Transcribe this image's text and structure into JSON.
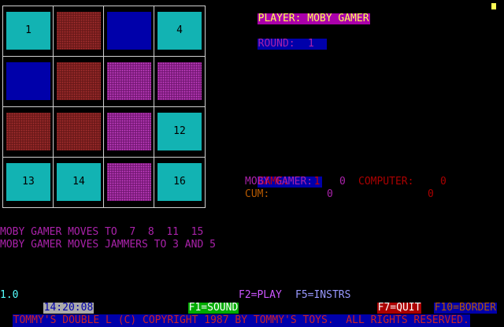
{
  "board": {
    "tiles": [
      {
        "label": "1",
        "color": "cyan"
      },
      {
        "label": "",
        "color": "brown"
      },
      {
        "label": "",
        "color": "blue"
      },
      {
        "label": "4",
        "color": "cyan"
      },
      {
        "label": "",
        "color": "blue"
      },
      {
        "label": "",
        "color": "brown"
      },
      {
        "label": "",
        "color": "magenta"
      },
      {
        "label": "",
        "color": "magenta"
      },
      {
        "label": "",
        "color": "brown"
      },
      {
        "label": "",
        "color": "brown"
      },
      {
        "label": "",
        "color": "magenta"
      },
      {
        "label": "12",
        "color": "cyan"
      },
      {
        "label": "13",
        "color": "cyan"
      },
      {
        "label": "14",
        "color": "cyan"
      },
      {
        "label": "",
        "color": "magenta"
      },
      {
        "label": "16",
        "color": "cyan"
      }
    ]
  },
  "player": {
    "label": "PLAYER: MOBY GAMER"
  },
  "round": {
    "label": "ROUND:",
    "value": "1"
  },
  "scores": {
    "game_label": "GAME:",
    "game_value": "1",
    "player_label": "MOBY GAMER:",
    "player_score": "0",
    "computer_label": "COMPUTER:",
    "computer_score": "0",
    "cum_label": "CUM:",
    "cum_player": "0",
    "cum_computer": "0"
  },
  "messages": [
    "MOBY GAMER MOVES TO  7  8  11  15",
    "MOBY GAMER MOVES JAMMERS TO 3 AND 5"
  ],
  "status": {
    "version": "1.0",
    "time": "14:20:08",
    "f1": "F1=SOUND",
    "f2": "F2=PLAY",
    "f5": "F5=INSTRS",
    "f7": "F7=QUIT",
    "f10": "F10=BORDER"
  },
  "copyright": "TOMMY'S DOUBLE L (C) COPYRIGHT 1987 BY TOMMY'S TOYS.  ALL RIGHTS RESERVED.",
  "colors": {
    "cyan": "#12b3b3",
    "blue": "#0000aa",
    "brown": "#6e1a1a",
    "magenta": "#7a1a7a",
    "yellow": "#ffff55",
    "purple_text": "#aa22aa",
    "red_text": "#aa0000",
    "orange_text": "#b85a00"
  }
}
